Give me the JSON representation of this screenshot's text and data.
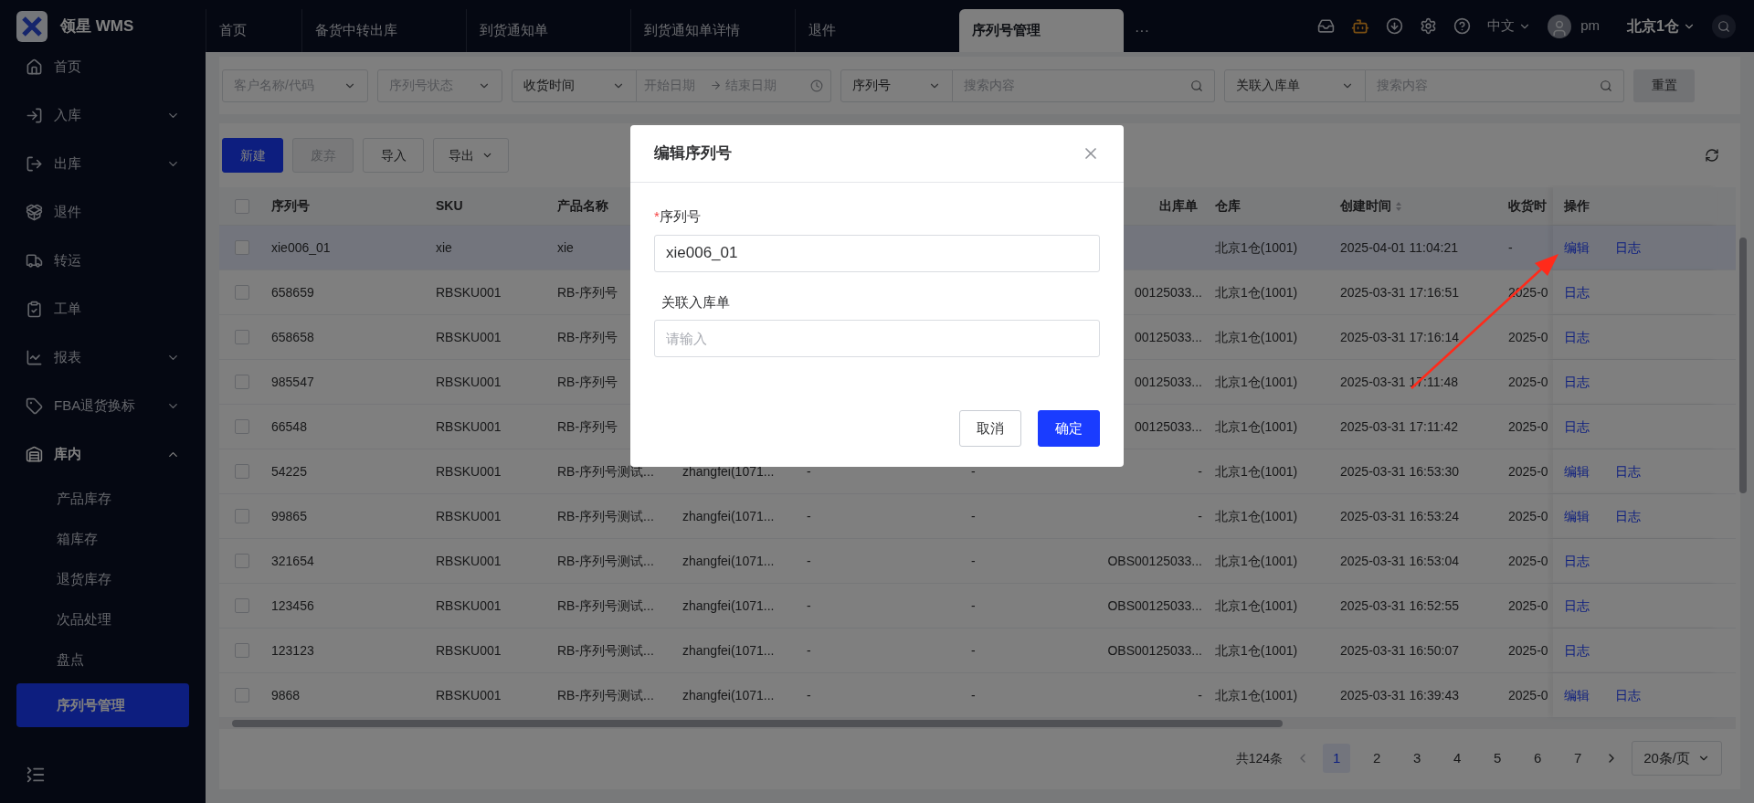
{
  "app": {
    "name": "领星 WMS"
  },
  "tabs": [
    {
      "label": "首页",
      "selected": false
    },
    {
      "label": "备货中转出库",
      "selected": false
    },
    {
      "label": "到货通知单",
      "selected": false
    },
    {
      "label": "到货通知单详情",
      "selected": false
    },
    {
      "label": "退件",
      "selected": false
    },
    {
      "label": "序列号管理",
      "selected": true
    }
  ],
  "tabs_more": "···",
  "header": {
    "language": "中文",
    "user": "pm",
    "warehouse": "北京1仓"
  },
  "sidebar": {
    "items": [
      {
        "label": "首页",
        "selected": false
      },
      {
        "label": "入库",
        "selected": false,
        "expanded": false
      },
      {
        "label": "出库",
        "selected": false,
        "expanded": false
      },
      {
        "label": "退件",
        "selected": false
      },
      {
        "label": "转运",
        "selected": false
      },
      {
        "label": "工单",
        "selected": false
      },
      {
        "label": "报表",
        "selected": false,
        "expanded": false
      },
      {
        "label": "FBA退货换标",
        "selected": false,
        "expanded": false
      },
      {
        "label": "库内",
        "selected": true,
        "expanded": true,
        "children": [
          {
            "label": "产品库存",
            "selected": false
          },
          {
            "label": "箱库存",
            "selected": false
          },
          {
            "label": "退货库存",
            "selected": false
          },
          {
            "label": "次品处理",
            "selected": false
          },
          {
            "label": "盘点",
            "selected": false
          },
          {
            "label": "序列号管理",
            "selected": true
          }
        ]
      }
    ]
  },
  "filters": [
    {
      "kind": "select",
      "placeholder": "客户名称/代码"
    },
    {
      "kind": "select",
      "placeholder": "序列号状态"
    },
    {
      "kind": "date_range",
      "select": "收货时间",
      "start_placeholder": "开始日期",
      "end_placeholder": "结束日期"
    },
    {
      "kind": "search",
      "select": "序列号",
      "placeholder": "搜索内容"
    },
    {
      "kind": "search",
      "select": "关联入库单",
      "placeholder": "搜索内容"
    }
  ],
  "reset_button": "重置",
  "toolbar": [
    {
      "label": "新建",
      "kind": "primary",
      "disabled": false
    },
    {
      "label": "废弃",
      "kind": "default",
      "disabled": true
    },
    {
      "label": "导入",
      "kind": "default",
      "disabled": false
    },
    {
      "label": "导出",
      "kind": "dropdown",
      "disabled": false
    }
  ],
  "table": {
    "select_all": {
      "checked": false
    },
    "columns": [
      {
        "label": "序列号"
      },
      {
        "label": "SKU"
      },
      {
        "label": "产品名称"
      },
      {},
      {},
      {},
      {
        "label": "出库单"
      },
      {
        "label": "仓库"
      },
      {
        "label": "创建时间",
        "sortable": true
      },
      {
        "label": "收货时"
      },
      {
        "label": "操作"
      }
    ],
    "rows": [
      {
        "selected": true,
        "checked": false,
        "cells": [
          "xie006_01",
          "xie",
          "xie",
          null,
          null,
          null,
          null,
          "北京1仓(1001)",
          "2025-04-01 11:04:21",
          "-"
        ],
        "actions": [
          "编辑",
          "日志"
        ]
      },
      {
        "selected": false,
        "checked": false,
        "cells": [
          "658659",
          "RBSKU001",
          "RB-序列号",
          null,
          null,
          null,
          "00125033...",
          "北京1仓(1001)",
          "2025-03-31 17:16:51",
          "2025-0"
        ],
        "actions": [
          "日志"
        ]
      },
      {
        "selected": false,
        "checked": false,
        "cells": [
          "658658",
          "RBSKU001",
          "RB-序列号",
          null,
          null,
          null,
          "00125033...",
          "北京1仓(1001)",
          "2025-03-31 17:16:14",
          "2025-0"
        ],
        "actions": [
          "日志"
        ]
      },
      {
        "selected": false,
        "checked": false,
        "cells": [
          "985547",
          "RBSKU001",
          "RB-序列号",
          null,
          null,
          null,
          "00125033...",
          "北京1仓(1001)",
          "2025-03-31 17:11:48",
          "2025-0"
        ],
        "actions": [
          "日志"
        ]
      },
      {
        "selected": false,
        "checked": false,
        "cells": [
          "66548",
          "RBSKU001",
          "RB-序列号",
          null,
          null,
          null,
          "00125033...",
          "北京1仓(1001)",
          "2025-03-31 17:11:42",
          "2025-0"
        ],
        "actions": [
          "日志"
        ]
      },
      {
        "selected": false,
        "checked": false,
        "cells": [
          "54225",
          "RBSKU001",
          "RB-序列号测试...",
          "zhangfei(1071...",
          "-",
          "-",
          "-",
          "北京1仓(1001)",
          "2025-03-31 16:53:30",
          "2025-0"
        ],
        "actions": [
          "编辑",
          "日志"
        ]
      },
      {
        "selected": false,
        "checked": false,
        "cells": [
          "99865",
          "RBSKU001",
          "RB-序列号测试...",
          "zhangfei(1071...",
          "-",
          "-",
          "-",
          "北京1仓(1001)",
          "2025-03-31 16:53:24",
          "2025-0"
        ],
        "actions": [
          "编辑",
          "日志"
        ]
      },
      {
        "selected": false,
        "checked": false,
        "cells": [
          "321654",
          "RBSKU001",
          "RB-序列号测试...",
          "zhangfei(1071...",
          "-",
          "-",
          "OBS00125033...",
          "北京1仓(1001)",
          "2025-03-31 16:53:04",
          "2025-0"
        ],
        "actions": [
          "日志"
        ]
      },
      {
        "selected": false,
        "checked": false,
        "cells": [
          "123456",
          "RBSKU001",
          "RB-序列号测试...",
          "zhangfei(1071...",
          "-",
          "-",
          "OBS00125033...",
          "北京1仓(1001)",
          "2025-03-31 16:52:55",
          "2025-0"
        ],
        "actions": [
          "日志"
        ]
      },
      {
        "selected": false,
        "checked": false,
        "cells": [
          "123123",
          "RBSKU001",
          "RB-序列号测试...",
          "zhangfei(1071...",
          "-",
          "-",
          "OBS00125033...",
          "北京1仓(1001)",
          "2025-03-31 16:50:07",
          "2025-0"
        ],
        "actions": [
          "日志"
        ]
      },
      {
        "selected": false,
        "checked": false,
        "cells": [
          "9868",
          "RBSKU001",
          "RB-序列号测试...",
          "zhangfei(1071...",
          "-",
          "-",
          "-",
          "北京1仓(1001)",
          "2025-03-31 16:39:43",
          "2025-0"
        ],
        "actions": [
          "编辑",
          "日志"
        ]
      }
    ]
  },
  "pagination": {
    "total": "共124条",
    "pages": [
      {
        "label": "1",
        "selected": true
      },
      {
        "label": "2",
        "selected": false
      },
      {
        "label": "3",
        "selected": false
      },
      {
        "label": "4",
        "selected": false
      },
      {
        "label": "5",
        "selected": false
      },
      {
        "label": "6",
        "selected": false
      },
      {
        "label": "7",
        "selected": false
      }
    ],
    "page_size": "20条/页"
  },
  "dialog": {
    "title": "编辑序列号",
    "required_mark": "*",
    "fields": [
      {
        "label": "序列号",
        "required": true,
        "value": "xie006_01"
      },
      {
        "label": "关联入库单",
        "required": false,
        "placeholder": "请输入"
      }
    ],
    "buttons": [
      {
        "label": "取消",
        "kind": "default"
      },
      {
        "label": "确定",
        "kind": "primary"
      }
    ]
  }
}
